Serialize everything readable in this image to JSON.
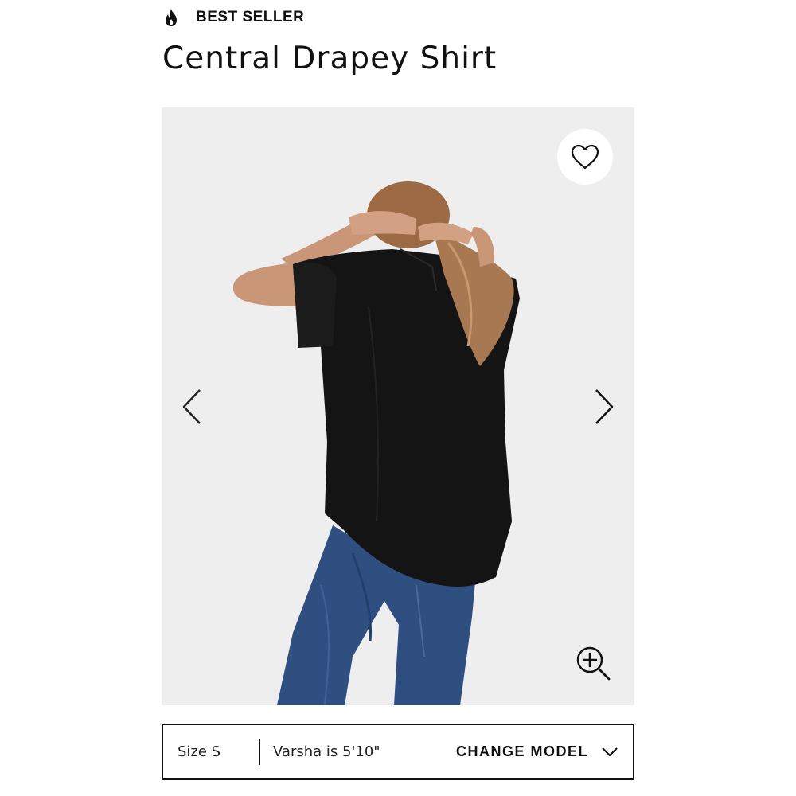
{
  "badge": {
    "icon": "flame-icon",
    "label": "BEST SELLER"
  },
  "product": {
    "title": "Central Drapey Shirt"
  },
  "gallery": {
    "image_alt": "Model wearing black short-sleeve drapey shirt with blue jeans, back view",
    "favorite_icon": "heart-icon",
    "prev_icon": "chevron-left-icon",
    "next_icon": "chevron-right-icon",
    "zoom_icon": "zoom-in-icon"
  },
  "model_bar": {
    "size": "Size S",
    "model_info": "Varsha is 5'10\"",
    "change_label": "CHANGE MODEL",
    "chevron_icon": "chevron-down-icon"
  },
  "colors": {
    "text": "#111111",
    "gallery_bg": "#eeeeef",
    "shirt": "#141414",
    "denim": "#2f4f80"
  }
}
